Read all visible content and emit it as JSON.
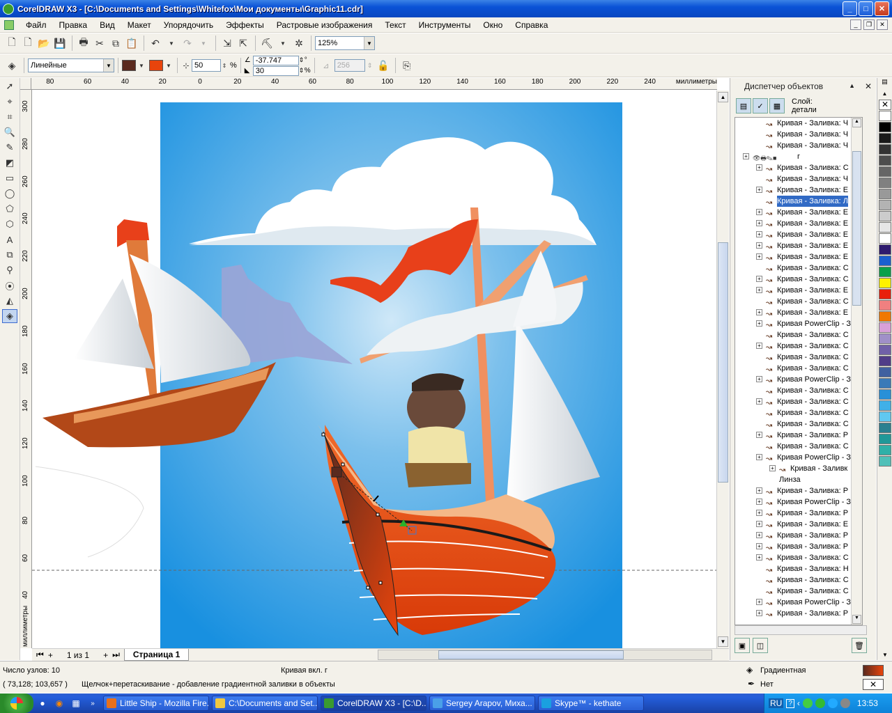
{
  "window": {
    "title": "CorelDRAW X3 - [C:\\Documents and Settings\\Whitefox\\Мои документы\\Graphic11.cdr]"
  },
  "menu": {
    "items": [
      "Файл",
      "Правка",
      "Вид",
      "Макет",
      "Упорядочить",
      "Эффекты",
      "Растровые изображения",
      "Текст",
      "Инструменты",
      "Окно",
      "Справка"
    ]
  },
  "toolbar": {
    "zoom": "125%"
  },
  "property_bar": {
    "fill_type": "Линейные",
    "color1": "#5a2a1e",
    "color2": "#e8440c",
    "midpoint": "50",
    "midpoint_unit": "%",
    "angle": "-37.747",
    "angle_unit": "°",
    "edge_pad": "30",
    "edge_unit": "%",
    "steps": "256"
  },
  "ruler": {
    "h_ticks": [
      "80",
      "60",
      "40",
      "20",
      "0",
      "20",
      "40",
      "60",
      "80",
      "100",
      "120",
      "140",
      "160",
      "180",
      "200",
      "220",
      "240"
    ],
    "h_unit": "миллиметры",
    "v_ticks": [
      "300",
      "280",
      "260",
      "240",
      "220",
      "200",
      "180",
      "160",
      "140",
      "120",
      "100",
      "80",
      "60",
      "40"
    ],
    "v_unit": "миллиметры"
  },
  "page_nav": {
    "counter": "1 из 1",
    "tab": "Страница 1"
  },
  "docker": {
    "title": "Диспетчер объектов",
    "layer_prefix": "Слой:",
    "layer_name": "детали",
    "tree": [
      {
        "label": "Кривая - Заливка: Ч",
        "ind": 2,
        "exp": false
      },
      {
        "label": "Кривая - Заливка: Ч",
        "ind": 2,
        "exp": false
      },
      {
        "label": "Кривая - Заливка: Ч",
        "ind": 2,
        "exp": false
      },
      {
        "label": "г",
        "ind": 1,
        "exp": true,
        "group": true
      },
      {
        "label": "Кривая - Заливка: С",
        "ind": 2,
        "exp": true
      },
      {
        "label": "Кривая - Заливка: Ч",
        "ind": 2,
        "exp": false
      },
      {
        "label": "Кривая - Заливка: Е",
        "ind": 2,
        "exp": true
      },
      {
        "label": "Кривая - Заливка: Л",
        "ind": 2,
        "exp": false,
        "sel": true
      },
      {
        "label": "Кривая - Заливка: Е",
        "ind": 2,
        "exp": true
      },
      {
        "label": "Кривая - Заливка: Е",
        "ind": 2,
        "exp": true
      },
      {
        "label": "Кривая - Заливка: Е",
        "ind": 2,
        "exp": true
      },
      {
        "label": "Кривая - Заливка: Е",
        "ind": 2,
        "exp": true
      },
      {
        "label": "Кривая - Заливка: Е",
        "ind": 2,
        "exp": true
      },
      {
        "label": "Кривая - Заливка: С",
        "ind": 2,
        "exp": false
      },
      {
        "label": "Кривая - Заливка: С",
        "ind": 2,
        "exp": true
      },
      {
        "label": "Кривая - Заливка: Е",
        "ind": 2,
        "exp": true
      },
      {
        "label": "Кривая - Заливка: С",
        "ind": 2,
        "exp": false
      },
      {
        "label": "Кривая - Заливка: Е",
        "ind": 2,
        "exp": true
      },
      {
        "label": "Кривая PowerClip - З",
        "ind": 2,
        "exp": true
      },
      {
        "label": "Кривая - Заливка: С",
        "ind": 2,
        "exp": false
      },
      {
        "label": "Кривая - Заливка: С",
        "ind": 2,
        "exp": true
      },
      {
        "label": "Кривая - Заливка: С",
        "ind": 2,
        "exp": false
      },
      {
        "label": "Кривая - Заливка: С",
        "ind": 2,
        "exp": false
      },
      {
        "label": "Кривая PowerClip - З",
        "ind": 2,
        "exp": true
      },
      {
        "label": "Кривая - Заливка: С",
        "ind": 2,
        "exp": false
      },
      {
        "label": "Кривая - Заливка: С",
        "ind": 2,
        "exp": true
      },
      {
        "label": "Кривая - Заливка: С",
        "ind": 2,
        "exp": false
      },
      {
        "label": "Кривая - Заливка: С",
        "ind": 2,
        "exp": false
      },
      {
        "label": "Кривая - Заливка: Р",
        "ind": 2,
        "exp": true
      },
      {
        "label": "Кривая - Заливка: С",
        "ind": 2,
        "exp": false
      },
      {
        "label": "Кривая PowerClip - З",
        "ind": 2,
        "exp": true
      },
      {
        "label": "Кривая - Заливк",
        "ind": 3,
        "exp": true
      },
      {
        "label": "Линза",
        "ind": 3,
        "exp": false,
        "noicon": true
      },
      {
        "label": "Кривая - Заливка: Р",
        "ind": 2,
        "exp": true
      },
      {
        "label": "Кривая PowerClip - З",
        "ind": 2,
        "exp": true
      },
      {
        "label": "Кривая - Заливка: Р",
        "ind": 2,
        "exp": true
      },
      {
        "label": "Кривая - Заливка: Е",
        "ind": 2,
        "exp": true
      },
      {
        "label": "Кривая - Заливка: Р",
        "ind": 2,
        "exp": true
      },
      {
        "label": "Кривая - Заливка: Р",
        "ind": 2,
        "exp": true
      },
      {
        "label": "Кривая - Заливка: С",
        "ind": 2,
        "exp": true
      },
      {
        "label": "Кривая - Заливка: Н",
        "ind": 2,
        "exp": false
      },
      {
        "label": "Кривая - Заливка: С",
        "ind": 2,
        "exp": false
      },
      {
        "label": "Кривая - Заливка: С",
        "ind": 2,
        "exp": false
      },
      {
        "label": "Кривая PowerClip - З",
        "ind": 2,
        "exp": true
      },
      {
        "label": "Кривая - Заливка: Р",
        "ind": 2,
        "exp": true
      }
    ]
  },
  "palette": [
    "#ffffff",
    "#000000",
    "#1a1a1a",
    "#333333",
    "#4d4d4d",
    "#666666",
    "#808080",
    "#999999",
    "#b3b3b3",
    "#cccccc",
    "#e6e6e6",
    "#ffffff",
    "#2e1a6e",
    "#1a5fd0",
    "#0aa04a",
    "#fff200",
    "#e8200c",
    "#f08080",
    "#f07800",
    "#d8a0d8",
    "#a090c8",
    "#7060a8",
    "#503c88",
    "#4060a0",
    "#3a7ab8",
    "#2890d8",
    "#40b0e8",
    "#60c8f0",
    "#2a8090",
    "#209898",
    "#30b0a8",
    "#50c0b8"
  ],
  "status": {
    "nodes": "Число узлов: 10",
    "object": "Кривая вкл. г",
    "coords": "( 73,128; 103,657 )",
    "hint": "Щелчок+перетаскивание - добавление градиентной заливки в объекты",
    "fill_label": "Градиентная",
    "outline_label": "Нет"
  },
  "taskbar": {
    "tasks": [
      {
        "label": "Little Ship - Mozilla Fire...",
        "color": "#e8701c"
      },
      {
        "label": "C:\\Documents and Set...",
        "color": "#f0c840"
      },
      {
        "label": "CorelDRAW X3 - [C:\\D...",
        "color": "#3a9a2f"
      },
      {
        "label": "Sergey Arapov, Миха...",
        "color": "#4aa0e8"
      },
      {
        "label": "Skype™ - kethate",
        "color": "#1aa0e0"
      }
    ],
    "lang": "RU",
    "time": "13:53"
  }
}
